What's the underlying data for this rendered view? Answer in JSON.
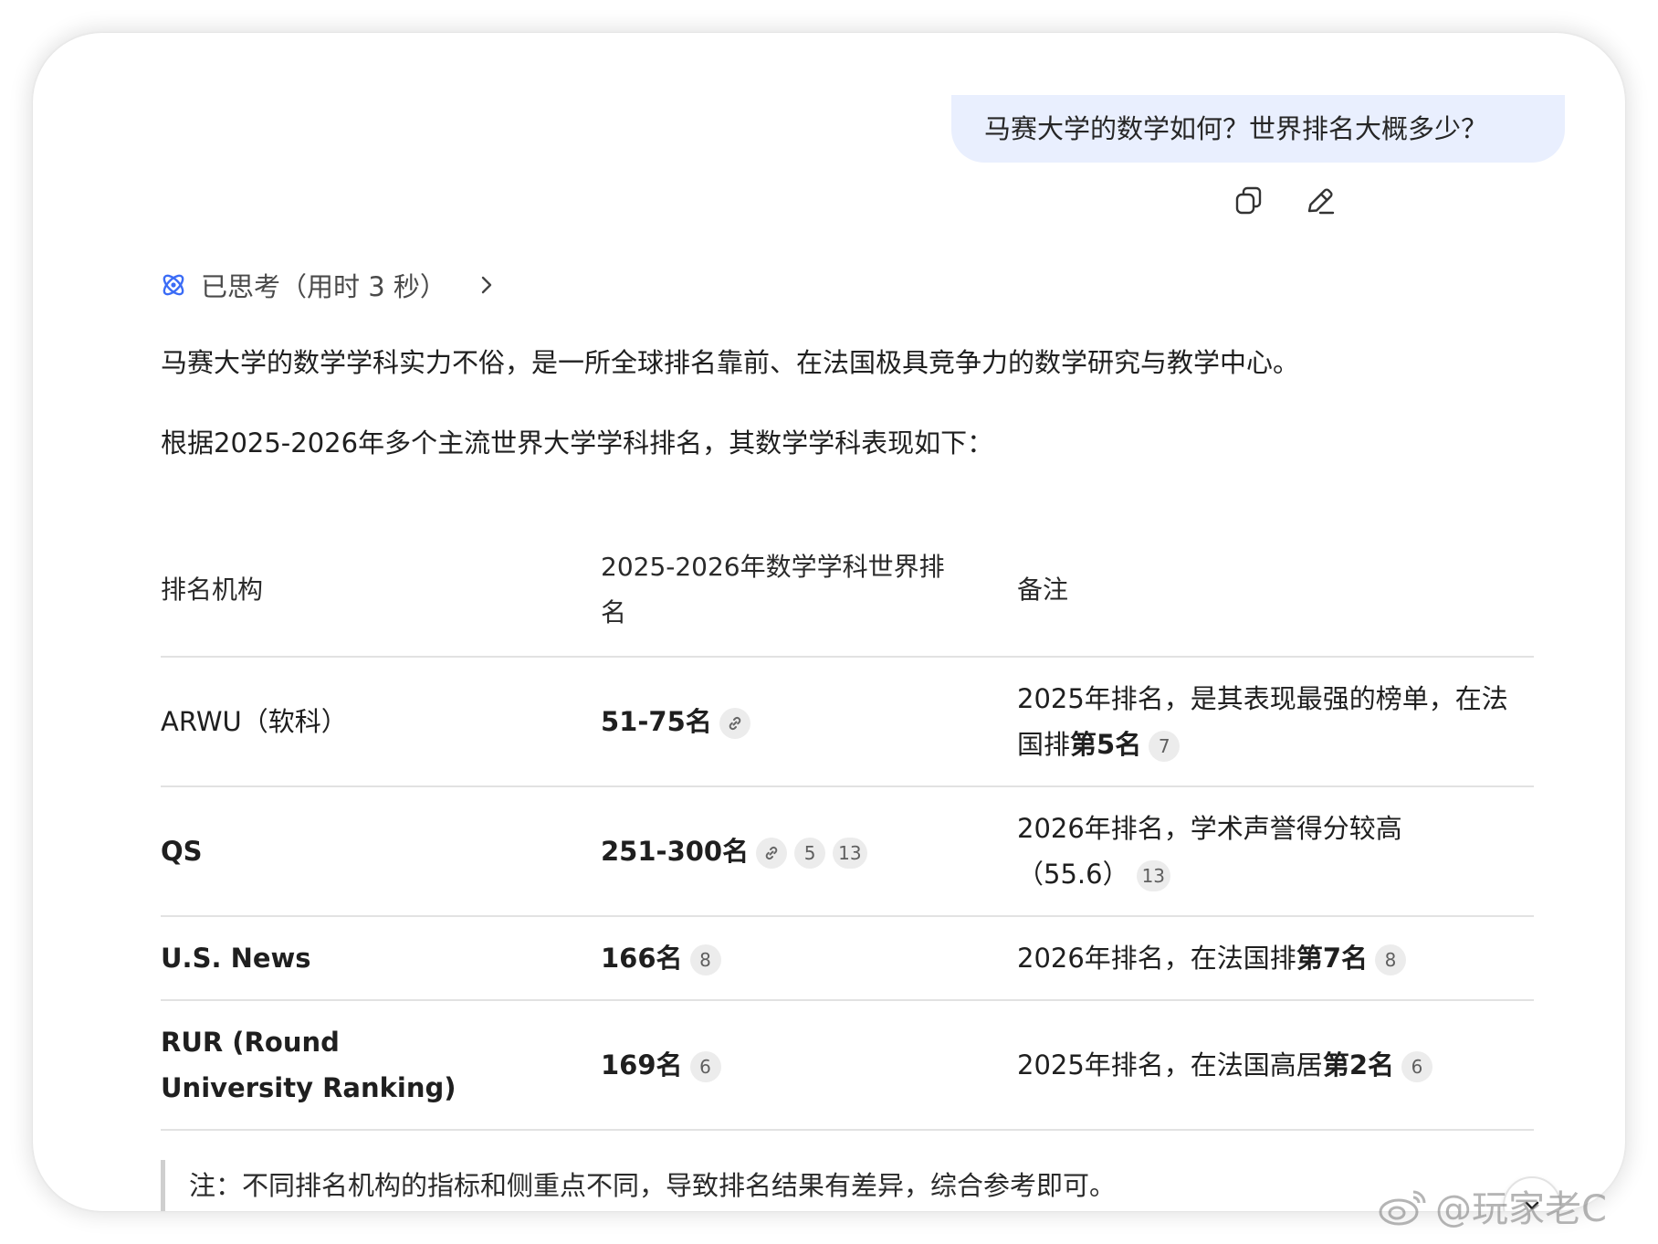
{
  "user_message": "马赛大学的数学如何？世界排名大概多少？",
  "actions": {
    "copy_icon": "copy-icon",
    "edit_icon": "edit-icon"
  },
  "thinking": {
    "label": "已思考（用时 3 秒）",
    "icon": "atom-icon"
  },
  "intro": "马赛大学的数学学科实力不俗，是一所全球排名靠前、在法国极具竞争力的数学研究与教学中心。",
  "lead": "根据2025-2026年多个主流世界大学学科排名，其数学学科表现如下：",
  "table": {
    "headers": [
      "排名机构",
      "2025-2026年数学学科世界排名",
      "备注"
    ],
    "rows": [
      {
        "org": "ARWU（软科）",
        "rank": "51-75名",
        "rank_cites": [
          "link"
        ],
        "note_pre": "2025年排名，是其表现最强的榜单，在法国排",
        "note_bold": "第5名",
        "note_cites": [
          "7"
        ]
      },
      {
        "org": "QS",
        "rank": "251-300名",
        "rank_cites": [
          "link",
          "5",
          "13"
        ],
        "note_pre": "2026年排名，学术声誉得分较高（55.6）",
        "note_bold": "",
        "note_cites": [
          "13"
        ]
      },
      {
        "org": "U.S. News",
        "rank": "166名",
        "rank_cites": [
          "8"
        ],
        "note_pre": "2026年排名，在法国排",
        "note_bold": "第7名",
        "note_cites": [
          "8"
        ]
      },
      {
        "org": "RUR (Round University Ranking)",
        "rank": "169名",
        "rank_cites": [
          "6"
        ],
        "note_pre": "2025年排名，在法国高居",
        "note_bold": "第2名",
        "note_cites": [
          "6"
        ]
      }
    ]
  },
  "footnote": "注：不同排名机构的指标和侧重点不同，导致排名结果有差异，综合参考即可。",
  "watermark": "@玩家老C",
  "colors": {
    "bubble": "#e9effe",
    "accent": "#3b6cf6",
    "cite_bg": "#ececec"
  }
}
